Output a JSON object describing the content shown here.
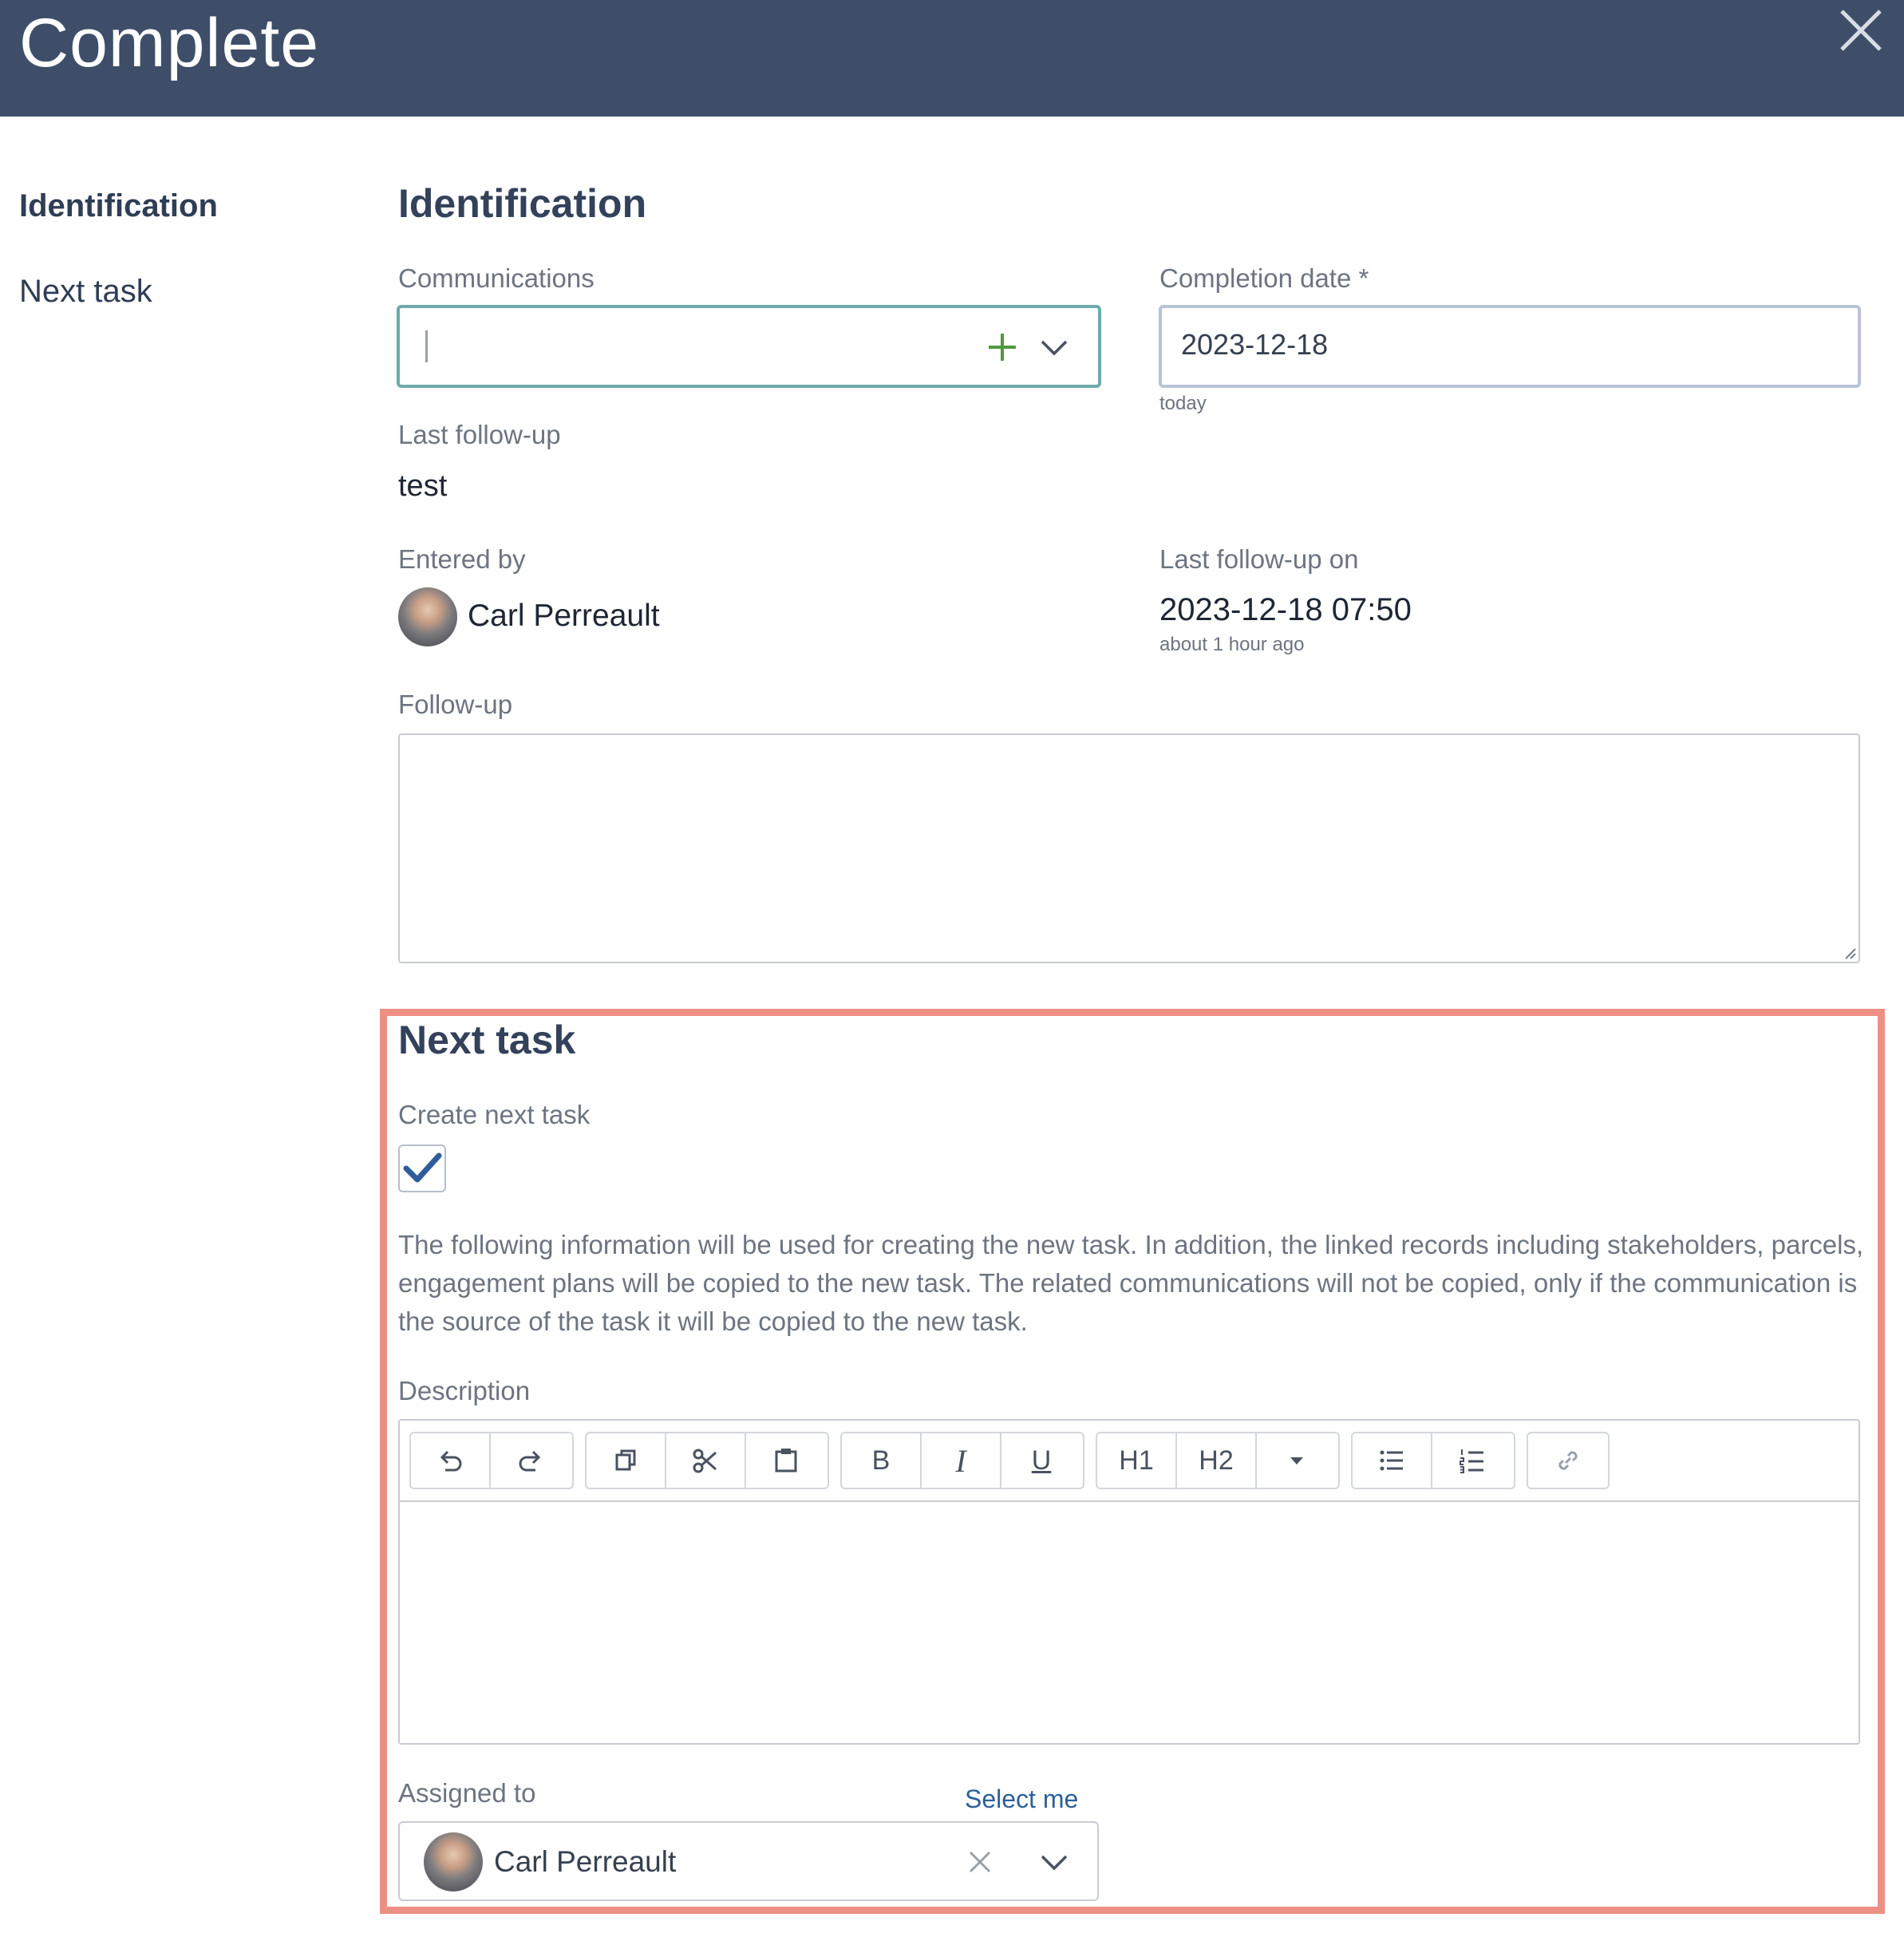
{
  "header": {
    "title": "Complete"
  },
  "nav": {
    "items": [
      {
        "label": "Identification",
        "active": true
      },
      {
        "label": "Next task",
        "active": false
      }
    ]
  },
  "identification": {
    "title": "Identification",
    "communications_label": "Communications",
    "communications_value": "",
    "completion_date_label": "Completion date *",
    "completion_date_value": "2023-12-18",
    "completion_date_hint": "today",
    "last_followup_label": "Last follow-up",
    "last_followup_value": "test",
    "entered_by_label": "Entered by",
    "entered_by_name": "Carl Perreault",
    "last_followup_on_label": "Last follow-up on",
    "last_followup_on_value": "2023-12-18 07:50",
    "last_followup_on_hint": "about 1 hour ago",
    "followup_label": "Follow-up",
    "followup_value": ""
  },
  "next_task": {
    "title": "Next task",
    "create_label": "Create next task",
    "create_checked": true,
    "info": "The following information will be used for creating the new task. In addition, the linked records including stakeholders, parcels, engagement plans will be copied to the new task. The related communications will not be copied, only if the communication is the source of the task it will be copied to the new task.",
    "description_label": "Description",
    "toolbar": {
      "bold": "B",
      "italic": "I",
      "underline": "U",
      "h1": "H1",
      "h2": "H2"
    },
    "assigned_label": "Assigned to",
    "select_me": "Select me",
    "assigned_name": "Carl Perreault"
  },
  "colors": {
    "header_bg": "#3e4e69",
    "highlight": "#ee8f86",
    "accent_green": "#4f9a3f",
    "link": "#2d6098",
    "check": "#2e5e9a"
  },
  "icons": [
    "close-icon",
    "add-icon",
    "chevron-down-icon",
    "undo-icon",
    "redo-icon",
    "copy-icon",
    "cut-icon",
    "paste-icon",
    "heading-dropdown-icon",
    "bullet-list-icon",
    "numbered-list-icon",
    "link-icon",
    "clear-icon",
    "checkmark-icon"
  ]
}
